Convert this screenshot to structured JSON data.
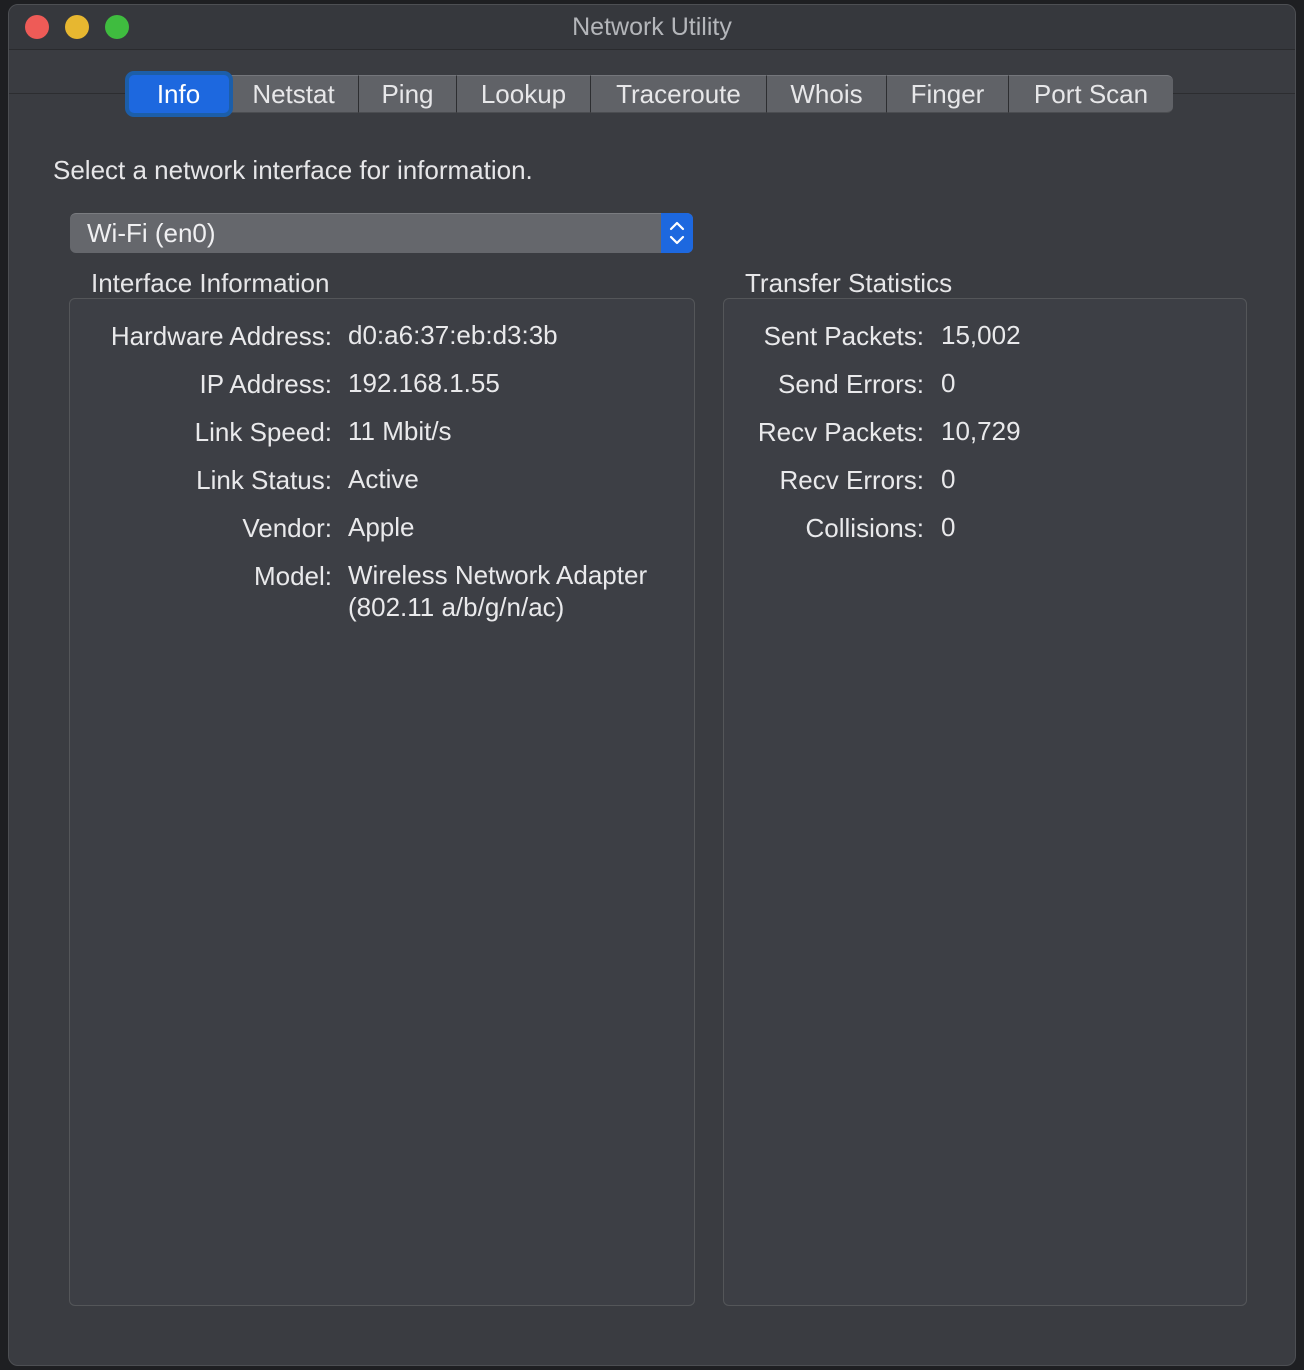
{
  "window": {
    "title": "Network Utility"
  },
  "tabs": [
    {
      "label": "Info",
      "active": true
    },
    {
      "label": "Netstat"
    },
    {
      "label": "Ping"
    },
    {
      "label": "Lookup"
    },
    {
      "label": "Traceroute"
    },
    {
      "label": "Whois"
    },
    {
      "label": "Finger"
    },
    {
      "label": "Port Scan"
    }
  ],
  "info": {
    "prompt": "Select a network interface for information.",
    "interface_select": {
      "value": "Wi-Fi (en0)"
    },
    "interface_information": {
      "title": "Interface Information",
      "rows": [
        {
          "key": "Hardware Address:",
          "value": "d0:a6:37:eb:d3:3b"
        },
        {
          "key": "IP Address:",
          "value": "192.168.1.55"
        },
        {
          "key": "Link Speed:",
          "value": "11 Mbit/s"
        },
        {
          "key": "Link Status:",
          "value": "Active"
        },
        {
          "key": "Vendor:",
          "value": "Apple"
        },
        {
          "key": "Model:",
          "value": "Wireless Network Adapter",
          "value2": "(802.11 a/b/g/n/ac)"
        }
      ]
    },
    "transfer_statistics": {
      "title": "Transfer Statistics",
      "rows": [
        {
          "key": "Sent Packets:",
          "value": "15,002"
        },
        {
          "key": "Send Errors:",
          "value": "0"
        },
        {
          "key": "Recv Packets:",
          "value": "10,729"
        },
        {
          "key": "Recv Errors:",
          "value": "0"
        },
        {
          "key": "Collisions:",
          "value": "0"
        }
      ]
    }
  }
}
